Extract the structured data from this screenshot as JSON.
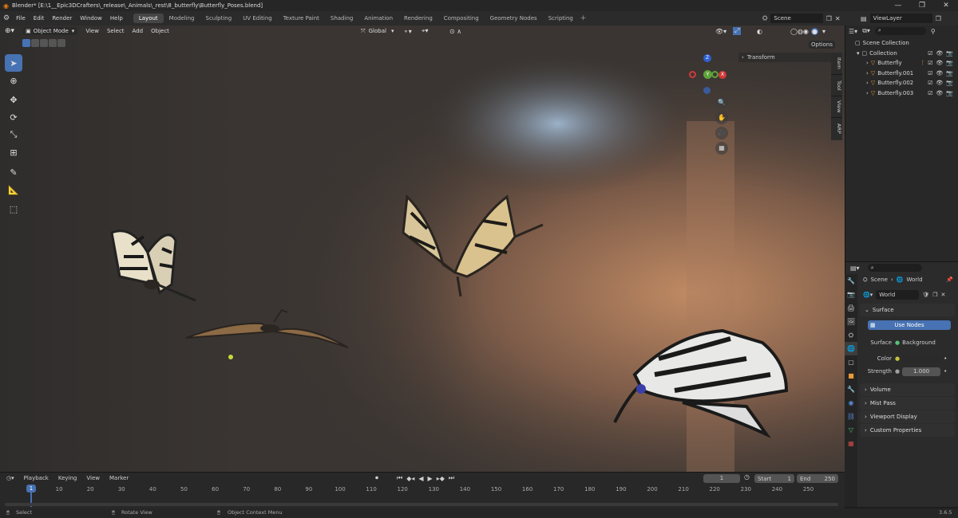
{
  "titlebar": {
    "title": "Blender* [E:\\1__Epic3DCrafters\\_release\\_Animals\\_rest\\8_butterfly\\Butterfly_Poses.blend]",
    "minimize": "—",
    "maximize": "❐",
    "close": "✕"
  },
  "menu": [
    "File",
    "Edit",
    "Render",
    "Window",
    "Help"
  ],
  "workspaces": [
    "Layout",
    "Modeling",
    "Sculpting",
    "UV Editing",
    "Texture Paint",
    "Shading",
    "Animation",
    "Rendering",
    "Compositing",
    "Geometry Nodes",
    "Scripting"
  ],
  "active_workspace": "Layout",
  "scene": {
    "label": "Scene",
    "viewlayer": "ViewLayer"
  },
  "viewport": {
    "mode": "Object Mode",
    "menus": [
      "View",
      "Select",
      "Add",
      "Object"
    ],
    "transform_orientation": "Global",
    "options": "Options",
    "transform_panel": "Transform",
    "side_tabs": [
      "Item",
      "Tool",
      "View",
      "ARP"
    ],
    "gizmo": {
      "z": "Z",
      "x": "X",
      "y": "Y"
    }
  },
  "outliner": {
    "root": "Scene Collection",
    "collection": "Collection",
    "items": [
      "Butterfly",
      "Butterfly.001",
      "Butterfly.002",
      "Butterfly.003"
    ]
  },
  "properties": {
    "breadcrumb_scene": "Scene",
    "breadcrumb_world": "World",
    "world_name": "World",
    "surface_panel": "Surface",
    "use_nodes": "Use Nodes",
    "surface_label": "Surface",
    "surface_value": "Background",
    "color_label": "Color",
    "strength_label": "Strength",
    "strength_value": "1.000",
    "panels": [
      "Volume",
      "Mist Pass",
      "Viewport Display",
      "Custom Properties"
    ],
    "colors": {
      "accent": "#4772b3"
    }
  },
  "timeline": {
    "menus": [
      "Playback",
      "Keying",
      "View",
      "Marker"
    ],
    "current_frame": "1",
    "start_label": "Start",
    "start": "1",
    "end_label": "End",
    "end": "250",
    "ticks": [
      "10",
      "20",
      "30",
      "40",
      "50",
      "60",
      "70",
      "80",
      "90",
      "100",
      "110",
      "120",
      "130",
      "140",
      "150",
      "160",
      "170",
      "180",
      "190",
      "200",
      "210",
      "220",
      "230",
      "240",
      "250"
    ],
    "playhead": "1"
  },
  "statusbar": {
    "select": "Select",
    "rotate": "Rotate View",
    "context": "Object Context Menu",
    "version": "3.6.5"
  }
}
